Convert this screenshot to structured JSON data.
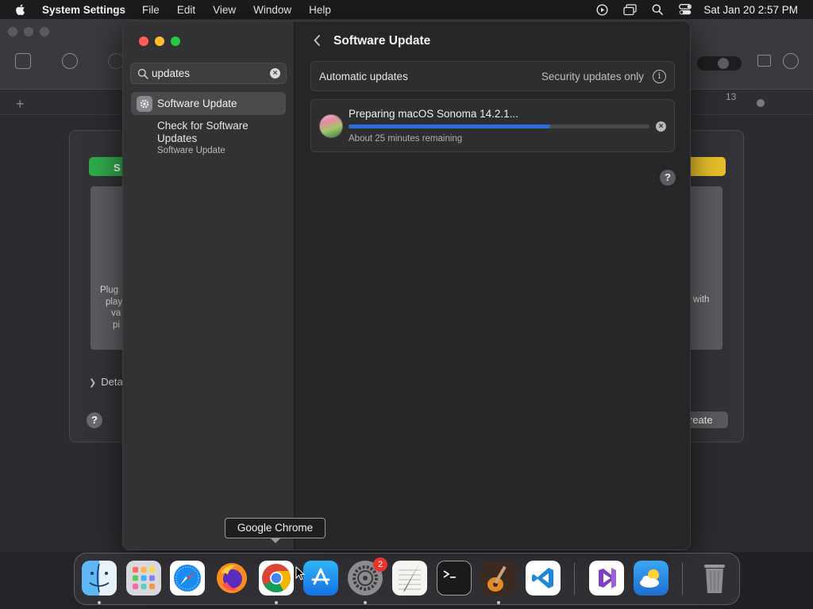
{
  "menubar": {
    "app_name": "System Settings",
    "items": [
      "File",
      "Edit",
      "View",
      "Window",
      "Help"
    ],
    "clock": "Sat Jan 20  2:57 PM"
  },
  "background_window": {
    "ruler_number": "13",
    "dialog": {
      "green_button_fragment": "S",
      "left_text": [
        "Plug",
        "play",
        "va",
        "pi"
      ],
      "right_text": "with",
      "details_label": "Deta",
      "create_button_fragment": "reate",
      "help_label": "?"
    }
  },
  "sidebar": {
    "search": {
      "value": "updates",
      "clear_label": "×"
    },
    "selected_item": {
      "label": "Software Update"
    },
    "sub_result": {
      "title": "Check for Software Updates",
      "detail": "Software Update"
    }
  },
  "content": {
    "title": "Software Update",
    "automatic_updates": {
      "label": "Automatic updates",
      "value": "Security updates only",
      "info_label": "i"
    },
    "update": {
      "title": "Preparing macOS Sonoma 14.2.1...",
      "progress": 0.67,
      "status": "About 25 minutes remaining",
      "cancel_label": "×"
    },
    "help_label": "?"
  },
  "tooltip": {
    "text": "Google Chrome"
  },
  "dock": {
    "apps": [
      {
        "name": "Finder",
        "running": true
      },
      {
        "name": "Launchpad",
        "running": false
      },
      {
        "name": "Safari",
        "running": false
      },
      {
        "name": "Firefox",
        "running": false
      },
      {
        "name": "Google Chrome",
        "running": true
      },
      {
        "name": "App Store",
        "running": false
      },
      {
        "name": "System Settings",
        "running": true,
        "badge": "2"
      },
      {
        "name": "TextEdit",
        "running": false
      },
      {
        "name": "Terminal",
        "running": false
      },
      {
        "name": "GarageBand",
        "running": true
      },
      {
        "name": "Visual Studio Code",
        "running": false
      },
      {
        "name": "Visual Studio",
        "running": false
      },
      {
        "name": "Weather",
        "running": false
      },
      {
        "name": "Trash",
        "running": false
      }
    ],
    "settings_badge": "2"
  },
  "colors": {
    "accent": "#2a6fdb",
    "close": "#ff5f57",
    "minimize": "#febc2e",
    "maximize": "#28c840",
    "badge": "#e5352d"
  }
}
